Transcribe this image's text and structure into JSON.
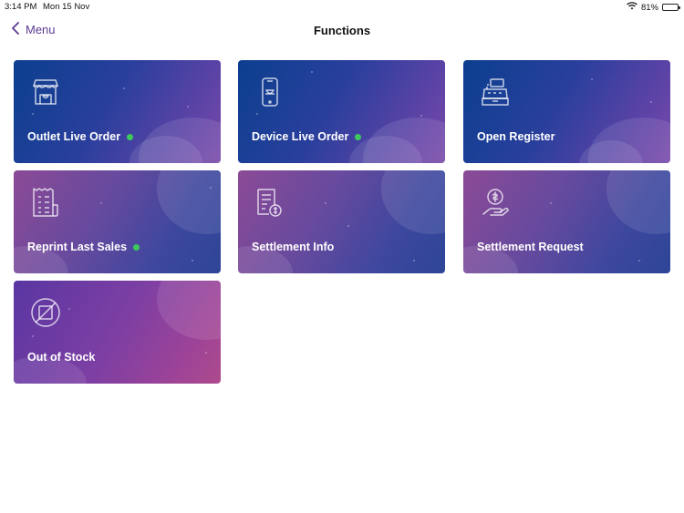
{
  "status_bar": {
    "time": "3:14 PM",
    "date": "Mon 15 Nov",
    "battery": "81%",
    "battery_level": 0.81,
    "wifi_icon": "wifi-icon",
    "battery_icon": "battery-icon"
  },
  "nav": {
    "back_label": "Menu",
    "back_icon": "chevron-left-icon",
    "title": "Functions"
  },
  "tiles": [
    {
      "label": "Outlet Live Order",
      "icon": "storefront-icon",
      "online": true
    },
    {
      "label": "Device Live Order",
      "icon": "mobile-device-icon",
      "online": true
    },
    {
      "label": "Open Register",
      "icon": "cash-register-icon",
      "online": false
    },
    {
      "label": "Reprint Last Sales",
      "icon": "receipt-icon",
      "online": true
    },
    {
      "label": "Settlement Info",
      "icon": "document-coin-icon",
      "online": false
    },
    {
      "label": "Settlement Request",
      "icon": "hand-coin-icon",
      "online": false
    },
    {
      "label": "Out of Stock",
      "icon": "out-of-stock-icon",
      "online": false
    }
  ],
  "colors": {
    "accent": "#5b3a8f",
    "online_indicator": "#3ec95c",
    "tile_text": "#ffffff"
  }
}
